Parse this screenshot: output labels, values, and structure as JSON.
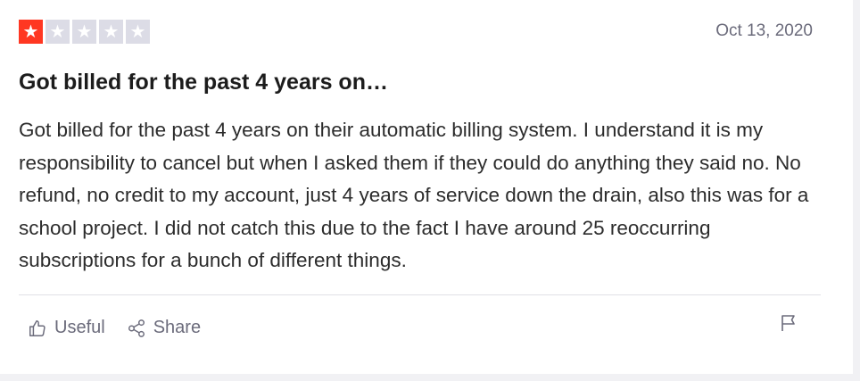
{
  "review": {
    "rating": 1,
    "max_rating": 5,
    "rating_color": "#ff3722",
    "empty_star_color": "#dcdce6",
    "star_icon": "star-icon",
    "date": "Oct 13, 2020",
    "title": "Got billed for the past 4 years on…",
    "body": "Got billed for the past 4 years on their automatic billing system. I understand it is my responsibility to cancel but when I asked them if they could do anything they said no. No refund, no credit to my account, just 4 years of service down the drain, also this was for a school project. I did not catch this due to the fact I have around 25 reoccurring subscriptions for a bunch of different things."
  },
  "actions": {
    "useful_label": "Useful",
    "useful_icon": "thumbs-up-icon",
    "share_label": "Share",
    "share_icon": "share-icon",
    "report_icon": "flag-icon"
  }
}
